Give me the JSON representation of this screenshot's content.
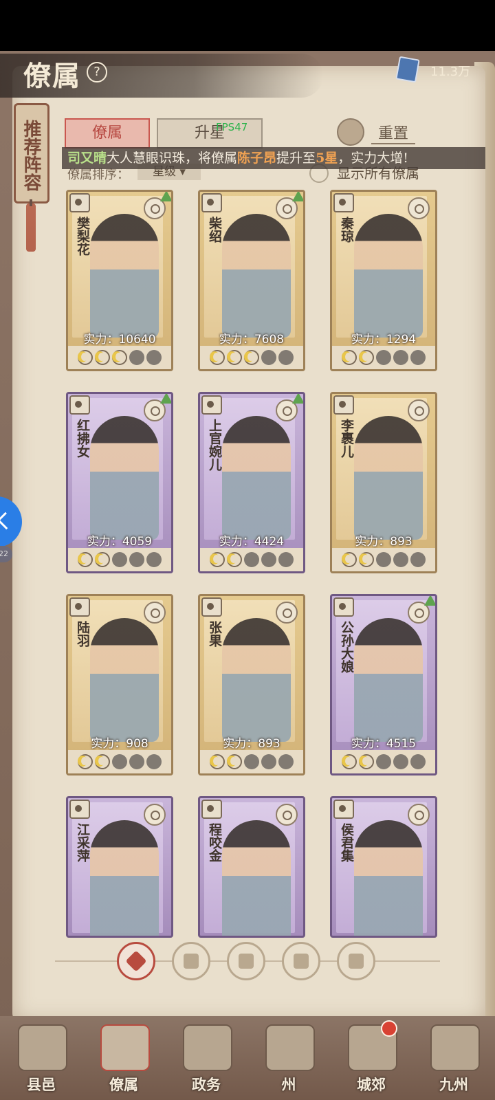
{
  "header": {
    "title": "僚属",
    "currency_value": "11.3万"
  },
  "banner": {
    "text": "推荐阵容"
  },
  "tabs": [
    {
      "label": "僚属",
      "active": true
    },
    {
      "label": "升星",
      "active": false
    }
  ],
  "fps_overlay": "FPS47",
  "reset_label": "重置",
  "notice": {
    "name1": "司又晴",
    "text1": "大人慧眼识珠，将僚属",
    "name2": "陈子昂",
    "text2": "提升至",
    "star": "5星",
    "text3": "，实力大增!"
  },
  "sort": {
    "label": "僚属排序：",
    "value": "星级 ▾"
  },
  "show_all_label": "显示所有僚属",
  "cards": [
    {
      "name": "樊梨花",
      "power": "实力：10640",
      "frame": "gold",
      "stars": 3,
      "upgradable": true
    },
    {
      "name": "柴绍",
      "power": "实力：7608",
      "frame": "gold",
      "stars": 3,
      "upgradable": true
    },
    {
      "name": "秦琼",
      "power": "实力：1294",
      "frame": "gold",
      "stars": 2,
      "upgradable": false
    },
    {
      "name": "红拂女",
      "power": "实力：4059",
      "frame": "purple",
      "stars": 2,
      "upgradable": true
    },
    {
      "name": "上官婉儿",
      "power": "实力：4424",
      "frame": "purple",
      "stars": 2,
      "upgradable": true
    },
    {
      "name": "李裹儿",
      "power": "实力：893",
      "frame": "gold",
      "stars": 2,
      "upgradable": false
    },
    {
      "name": "陆羽",
      "power": "实力：908",
      "frame": "gold",
      "stars": 2,
      "upgradable": false
    },
    {
      "name": "张果",
      "power": "实力：893",
      "frame": "gold",
      "stars": 2,
      "upgradable": false
    },
    {
      "name": "公孙大娘",
      "power": "实力：4515",
      "frame": "purple",
      "stars": 2,
      "upgradable": true
    },
    {
      "name": "江采萍",
      "power": "",
      "frame": "purple",
      "stars": 0,
      "upgradable": false
    },
    {
      "name": "程咬金",
      "power": "",
      "frame": "purple",
      "stars": 0,
      "upgradable": false
    },
    {
      "name": "侯君集",
      "power": "",
      "frame": "purple",
      "stars": 0,
      "upgradable": false
    }
  ],
  "filters": [
    {
      "icon": "all-filter-icon",
      "active": true
    },
    {
      "icon": "bell-filter-icon",
      "active": false
    },
    {
      "icon": "cat-filter-icon",
      "active": false
    },
    {
      "icon": "fan-filter-icon",
      "active": false
    },
    {
      "icon": "lion-filter-icon",
      "active": false
    }
  ],
  "bottom_nav": [
    {
      "label": "县邑",
      "active": false
    },
    {
      "label": "僚属",
      "active": true
    },
    {
      "label": "政务",
      "active": false
    },
    {
      "label": "州",
      "active": false
    },
    {
      "label": "城郊",
      "active": false
    },
    {
      "label": "九州",
      "active": false
    }
  ],
  "side_badge": "22",
  "colors": {
    "accent_red": "#b84b3f",
    "parchment": "#e9dfcc",
    "gold_frame": "#d2b277",
    "purple_frame": "#a58cbb"
  }
}
